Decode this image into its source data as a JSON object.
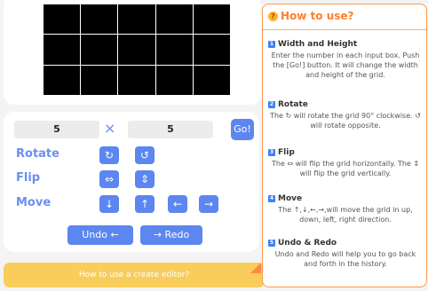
{
  "grid": {
    "columns": 5,
    "rows": 3
  },
  "controls": {
    "width_value": "5",
    "times_symbol": "×",
    "height_value": "5",
    "go_label": "Go!",
    "rotate_label": "Rotate",
    "flip_label": "Flip",
    "move_label": "Move",
    "rotate_cw_glyph": "↻",
    "rotate_ccw_glyph": "↺",
    "flip_h_glyph": "⇔",
    "flip_v_glyph": "⇕",
    "move_down": "↓",
    "move_up": "↑",
    "move_left": "←",
    "move_right": "→",
    "undo_label": "Undo ←",
    "redo_label": "→ Redo"
  },
  "banner": {
    "text": "How to use a create editor?"
  },
  "help": {
    "emoji": "?",
    "title": "How to use?",
    "sections": [
      {
        "num": "1",
        "heading": "Width and Height",
        "body": "Enter the number in each input box. Push the [Go!] button. It will change the width and height of the grid."
      },
      {
        "num": "2",
        "heading": "Rotate",
        "body": "The ↻ will rotate the grid 90° clockwise. ↺ will rotate opposite."
      },
      {
        "num": "3",
        "heading": "Flip",
        "body": "The ⇔ will flip the grid horizontally. The ⇕ will flip the grid vertically."
      },
      {
        "num": "4",
        "heading": "Move",
        "body": "The ↑,↓,←,→,will move the grid in up, down, left, right direction."
      },
      {
        "num": "5",
        "heading": "Undo & Redo",
        "body": "Undo and Redo will help you to go back and forth in the history."
      }
    ]
  }
}
